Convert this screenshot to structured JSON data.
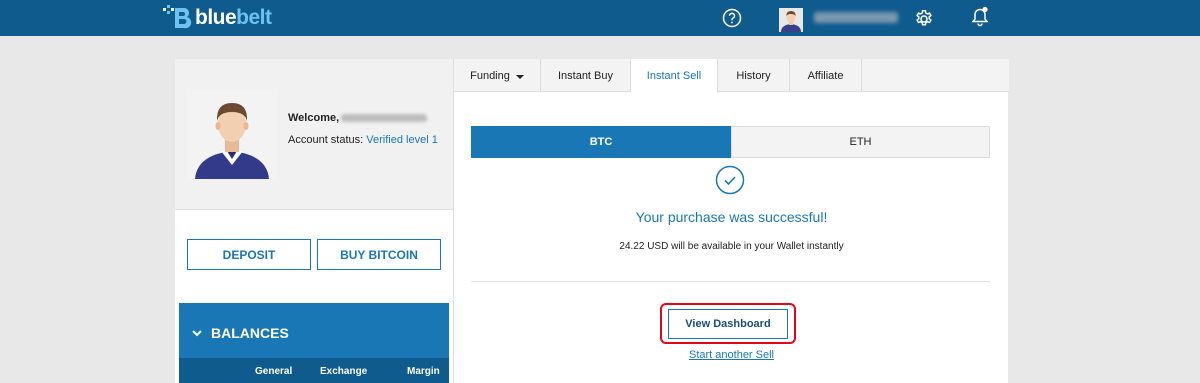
{
  "header": {
    "logo_blue": "blue",
    "logo_belt": "belt",
    "icons": [
      "help-icon",
      "user-avatar",
      "gear-icon",
      "bell-icon"
    ],
    "colors": {
      "bar": "#0f5b8e",
      "accent": "#1a77b5",
      "accent_light": "#6ec3ee"
    }
  },
  "profile": {
    "welcome_label": "Welcome,",
    "status_label": "Account status:",
    "status_value": "Verified level 1"
  },
  "actions": {
    "deposit": "DEPOSIT",
    "buy_bitcoin": "BUY BITCOIN"
  },
  "balances": {
    "title": "BALANCES",
    "columns": [
      "General",
      "Exchange",
      "Margin"
    ]
  },
  "tabs": [
    {
      "label": "Funding",
      "active": false
    },
    {
      "label": "Instant Buy",
      "active": false
    },
    {
      "label": "Instant Sell",
      "active": true
    },
    {
      "label": "History",
      "active": false
    },
    {
      "label": "Affiliate",
      "active": false
    }
  ],
  "currency": {
    "btc": "BTC",
    "eth": "ETH",
    "selected": "BTC"
  },
  "result": {
    "success_message": "Your purchase was successful!",
    "availability_message": "24.22 USD will be available in your Wallet instantly",
    "view_dashboard": "View Dashboard",
    "start_another": "Start another Sell"
  },
  "highlight_color": "#e3071a"
}
